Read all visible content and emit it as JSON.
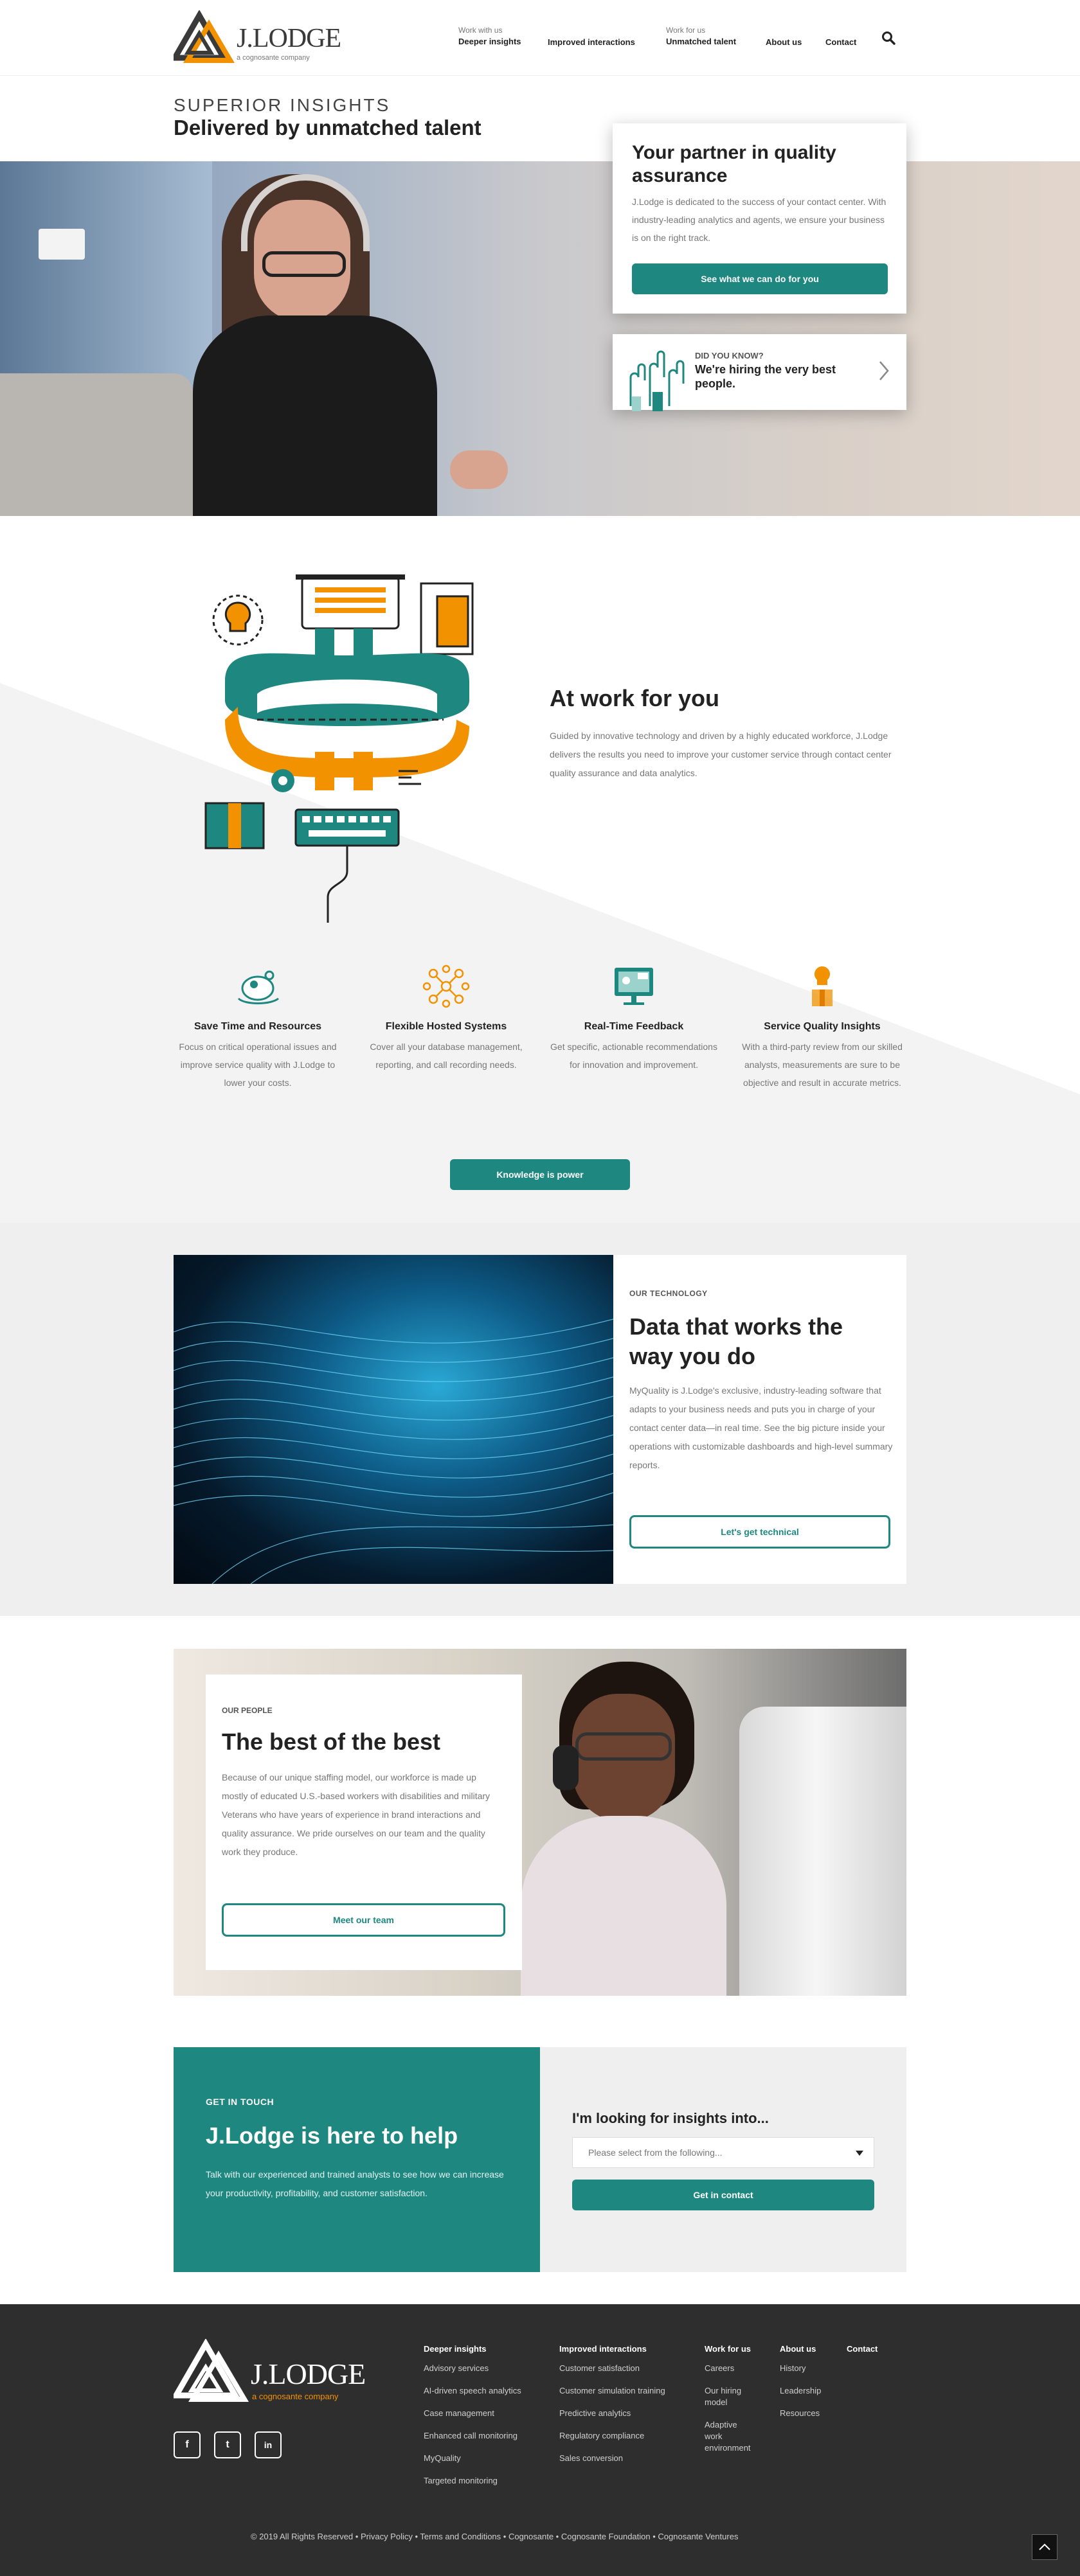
{
  "brand": {
    "name": "J.LODGE",
    "tagline": "a cognosante company",
    "colors": {
      "teal": "#1d8780",
      "orange": "#f39200",
      "dark": "#2e2e2e"
    }
  },
  "nav": {
    "items": [
      {
        "sub": "Work with us",
        "label": "Deeper insights"
      },
      {
        "sub": "",
        "label": "Improved interactions"
      },
      {
        "sub": "Work for us",
        "label": "Unmatched talent"
      },
      {
        "sub": "",
        "label": "About us"
      },
      {
        "sub": "",
        "label": "Contact"
      }
    ],
    "search_icon": "search-icon"
  },
  "hero": {
    "eyebrow": "SUPERIOR INSIGHTS",
    "title": "Delivered by unmatched talent",
    "card_title": "Your partner in quality assurance",
    "card_text": "J.Lodge is dedicated to the success of your contact center. With industry-leading analytics and agents, we ensure your business is on the right track.",
    "card_button": "See what we can do for you",
    "know_eyebrow": "DID YOU KNOW?",
    "know_text": "We're hiring the very best people."
  },
  "work": {
    "title": "At work for you",
    "text": "Guided by innovative technology and driven by a highly educated workforce, J.Lodge delivers the results you need to improve your customer service through contact center quality assurance and data analytics."
  },
  "features": [
    {
      "icon": "piggy-bank-icon",
      "title": "Save Time and Resources",
      "text": "Focus on critical operational issues and improve service quality with J.Lodge to lower your costs."
    },
    {
      "icon": "network-icon",
      "title": "Flexible Hosted Systems",
      "text": "Cover all your database management, reporting, and call recording needs."
    },
    {
      "icon": "monitor-feedback-icon",
      "title": "Real-Time Feedback",
      "text": "Get specific, actionable recommendations for innovation and improvement."
    },
    {
      "icon": "lightbulb-box-icon",
      "title": "Service Quality Insights",
      "text": "With a third-party review from our skilled analysts, measurements are sure to be objective and result in accurate metrics."
    }
  ],
  "knowledge_button": "Knowledge is power",
  "tech": {
    "eyebrow": "OUR TECHNOLOGY",
    "title": "Data that works the way you do",
    "text": "MyQuality is J.Lodge's exclusive, industry-leading software that adapts to your business needs and puts you in charge of your contact center data—in real time. See the big picture inside your operations with customizable dashboards and high-level summary reports.",
    "button": "Let's get technical"
  },
  "people": {
    "eyebrow": "OUR PEOPLE",
    "title": "The best of the best",
    "text": "Because of our unique staffing model, our workforce is made up mostly of educated U.S.-based workers with disabilities and military Veterans who have years of experience in brand interactions and quality assurance. We pride ourselves on our team and the quality work they produce.",
    "button": "Meet our team"
  },
  "contact": {
    "eyebrow": "GET IN TOUCH",
    "title": "J.Lodge is here to help",
    "text": "Talk with our experienced and trained analysts to see how we can increase your productivity, profitability, and customer satisfaction.",
    "form_title": "I'm looking for insights into...",
    "select_value": "Please select from the following...",
    "button": "Get in contact"
  },
  "footer": {
    "columns": [
      {
        "head": "Deeper insights",
        "links": [
          "Advisory services",
          "AI-driven speech analytics",
          "Case management",
          "Enhanced call monitoring",
          "MyQuality",
          "Targeted monitoring"
        ]
      },
      {
        "head": "Improved interactions",
        "links": [
          "Customer satisfaction",
          "Customer simulation training",
          "Predictive analytics",
          "Regulatory compliance",
          "Sales conversion"
        ]
      },
      {
        "head": "Work for us",
        "links": [
          "Careers",
          "Our hiring model",
          "Adaptive work environment"
        ]
      },
      {
        "head": "About us",
        "links": [
          "History",
          "Leadership",
          "Resources"
        ]
      },
      {
        "head": "Contact",
        "links": []
      }
    ],
    "social": [
      "f",
      "t",
      "in"
    ],
    "copyright": "© 2019 All Rights Reserved",
    "legal": [
      "Privacy Policy",
      "Terms and Conditions",
      "Cognosante",
      "Cognosante Foundation",
      "Cognosante Ventures"
    ],
    "top_icon": "chevron-up-icon"
  }
}
